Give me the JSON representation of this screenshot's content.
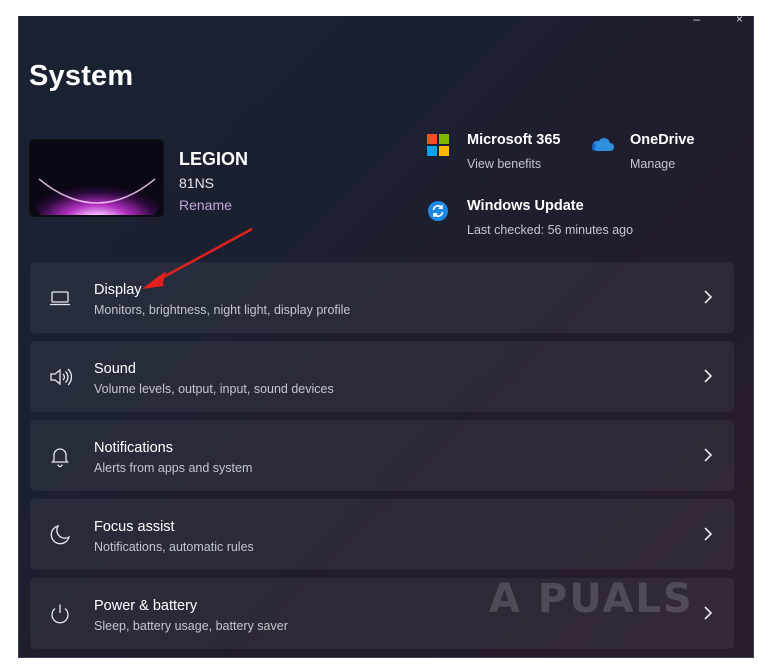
{
  "window": {
    "title": "System"
  },
  "device": {
    "name": "LEGION",
    "model": "81NS",
    "rename_label": "Rename"
  },
  "quick_links": [
    {
      "title": "Microsoft 365",
      "sub": "View benefits",
      "icon": "microsoft-365-icon"
    },
    {
      "title": "OneDrive",
      "sub": "Manage",
      "icon": "onedrive-icon"
    },
    {
      "title": "Windows Update",
      "sub": "Last checked: 56 minutes ago",
      "icon": "windows-update-icon"
    }
  ],
  "settings": [
    {
      "title": "Display",
      "sub": "Monitors, brightness, night light, display profile",
      "icon": "laptop-icon"
    },
    {
      "title": "Sound",
      "sub": "Volume levels, output, input, sound devices",
      "icon": "speaker-icon"
    },
    {
      "title": "Notifications",
      "sub": "Alerts from apps and system",
      "icon": "bell-icon"
    },
    {
      "title": "Focus assist",
      "sub": "Notifications, automatic rules",
      "icon": "moon-icon"
    },
    {
      "title": "Power & battery",
      "sub": "Sleep, battery usage, battery saver",
      "icon": "power-icon"
    }
  ],
  "watermark": "A  PUALS",
  "colors": {
    "accent": "#c3a6d9",
    "annotation_arrow": "#e0201e",
    "update_blue": "#1e88e5",
    "ms_red": "#f25022",
    "ms_green": "#7fba00",
    "ms_blue": "#00a4ef",
    "ms_yellow": "#ffb900"
  }
}
